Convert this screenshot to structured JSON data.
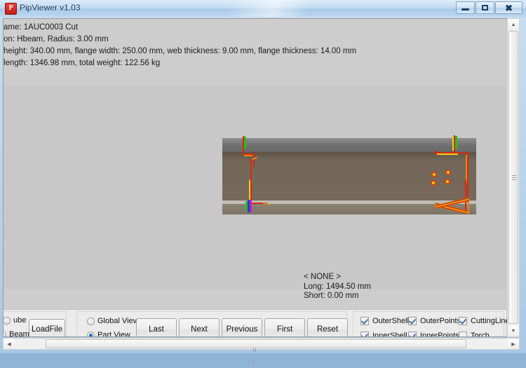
{
  "window": {
    "title": "PipViewer v1.03",
    "icon_letter": "P",
    "buttons": {
      "minimize": "minimize-button",
      "maximize": "maximize-button",
      "close": "close-button"
    }
  },
  "info": {
    "line1": "ame:  1AUC0003  Cut",
    "line2": "on: Hbeam,  Radius: 3.00 mm",
    "line3": "height: 340.00 mm,  flange width: 250.00 mm,  web thickness: 9.00 mm,  flange thickness: 14.00 mm",
    "line4": "length: 1346.98 mm,  total weight: 122.56 kg"
  },
  "status": {
    "selection": "< NONE >",
    "long": "Long: 1494.50 mm",
    "short": "Short: 0.00 mm"
  },
  "toolbar": {
    "type_group": {
      "tube_label": "ube",
      "beam_label": "Beam",
      "tube_selected": false,
      "beam_selected": false
    },
    "load_file_label": "LoadFile",
    "view_modes": [
      {
        "label": "Global Viev",
        "selected": false
      },
      {
        "label": "Part View",
        "selected": true
      }
    ],
    "nav_buttons": [
      {
        "label": "Last"
      },
      {
        "label": "Next"
      },
      {
        "label": "Previous"
      },
      {
        "label": "First"
      },
      {
        "label": "Reset"
      }
    ],
    "display_options": [
      {
        "label": "OuterShell",
        "checked": true
      },
      {
        "label": "OuterPoints",
        "checked": true
      },
      {
        "label": "CuttingLine",
        "checked": true
      },
      {
        "label": "InnerShell",
        "checked": true
      },
      {
        "label": "InnerPoints",
        "checked": true
      },
      {
        "label": "Torch",
        "checked": false
      }
    ]
  },
  "scrollbars": {
    "vertical": {
      "up_glyph": "▲",
      "down_glyph": "▼"
    },
    "horizontal": {
      "left_glyph": "◀",
      "right_glyph": "▶"
    }
  },
  "colors": {
    "viewport_background": "#c8c8c8",
    "beam_web": "#77695a",
    "beam_flange_top": "#6f6f6f",
    "beam_flange_bottom": "#837a6c",
    "cutting_line_red": "#d42b12",
    "cutting_line_yellow": "#e8d218",
    "axis_green": "#22c215",
    "axis_blue": "#2a38d8",
    "axis_magenta": "#c022c0",
    "titlebar_text": "#16334f"
  }
}
